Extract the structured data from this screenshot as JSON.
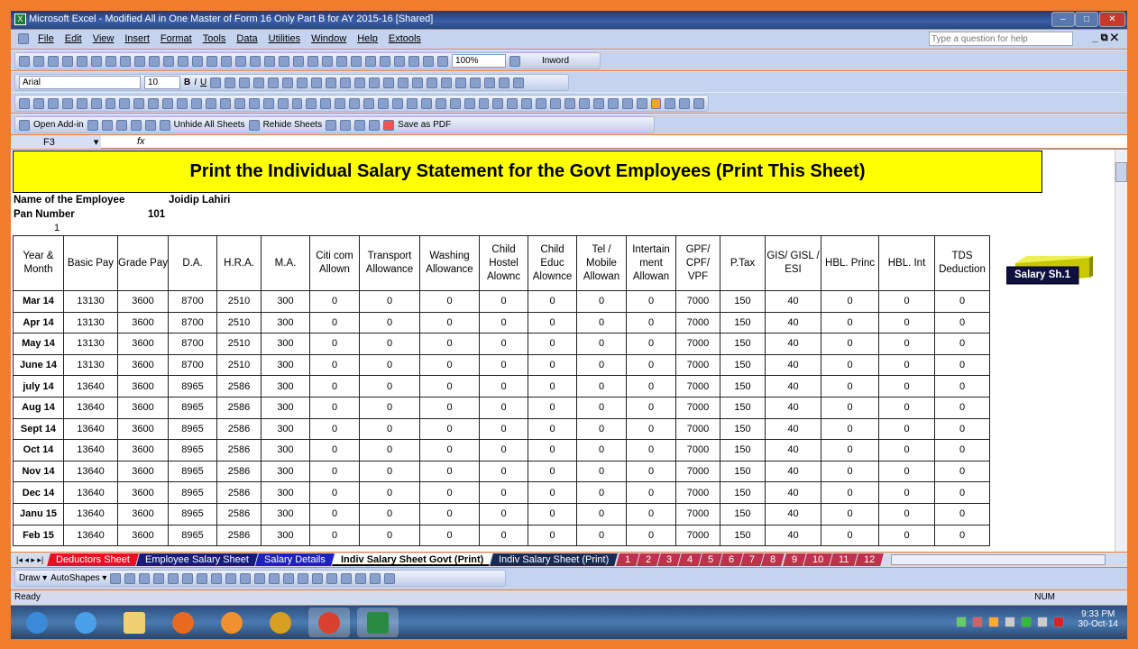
{
  "window": {
    "title": "Microsoft Excel - Modified All in One Master of Form 16 Only Part  B for AY 2015-16  [Shared]"
  },
  "menu": [
    "File",
    "Edit",
    "View",
    "Insert",
    "Format",
    "Tools",
    "Data",
    "Utilities",
    "Window",
    "Help",
    "Extools"
  ],
  "help_placeholder": "Type a question for help",
  "toolbar": {
    "zoom": "100%",
    "inword": "Inword",
    "font": "Arial",
    "size": "10",
    "open_addin": "Open Add-in",
    "unhide": "Unhide All Sheets",
    "rehide": "Rehide Sheets",
    "save_pdf": "Save as PDF"
  },
  "formula": {
    "cell": "F3",
    "fx": "fx"
  },
  "sheet": {
    "title": "Print the Individual Salary Statement for the Govt Employees (Print This Sheet)",
    "name_label": "Name of the Employee",
    "name_value": "Joidip Lahiri",
    "pan_label": "Pan Number",
    "pan_value": "101",
    "index": "1",
    "button": "Salary Sh.1",
    "headers": [
      "Year & Month",
      "Basic Pay",
      "Grade Pay",
      "D.A.",
      "H.R.A.",
      "M.A.",
      "Citi com Allown",
      "Transport Allowance",
      "Washing Allowance",
      "Child Hostel Alownc",
      "Child Educ Alownce",
      "Tel / Mobile Allowan",
      "Intertain ment Allowan",
      "GPF/ CPF/ VPF",
      "P.Tax",
      "GIS/ GISL / ESI",
      "HBL. Princ",
      "HBL. Int",
      "TDS Deduction"
    ],
    "rows": [
      [
        "Mar 14",
        "13130",
        "3600",
        "8700",
        "2510",
        "300",
        "0",
        "0",
        "0",
        "0",
        "0",
        "0",
        "0",
        "7000",
        "150",
        "40",
        "0",
        "0",
        "0"
      ],
      [
        "Apr 14",
        "13130",
        "3600",
        "8700",
        "2510",
        "300",
        "0",
        "0",
        "0",
        "0",
        "0",
        "0",
        "0",
        "7000",
        "150",
        "40",
        "0",
        "0",
        "0"
      ],
      [
        "May 14",
        "13130",
        "3600",
        "8700",
        "2510",
        "300",
        "0",
        "0",
        "0",
        "0",
        "0",
        "0",
        "0",
        "7000",
        "150",
        "40",
        "0",
        "0",
        "0"
      ],
      [
        "June 14",
        "13130",
        "3600",
        "8700",
        "2510",
        "300",
        "0",
        "0",
        "0",
        "0",
        "0",
        "0",
        "0",
        "7000",
        "150",
        "40",
        "0",
        "0",
        "0"
      ],
      [
        "july 14",
        "13640",
        "3600",
        "8965",
        "2586",
        "300",
        "0",
        "0",
        "0",
        "0",
        "0",
        "0",
        "0",
        "7000",
        "150",
        "40",
        "0",
        "0",
        "0"
      ],
      [
        "Aug 14",
        "13640",
        "3600",
        "8965",
        "2586",
        "300",
        "0",
        "0",
        "0",
        "0",
        "0",
        "0",
        "0",
        "7000",
        "150",
        "40",
        "0",
        "0",
        "0"
      ],
      [
        "Sept 14",
        "13640",
        "3600",
        "8965",
        "2586",
        "300",
        "0",
        "0",
        "0",
        "0",
        "0",
        "0",
        "0",
        "7000",
        "150",
        "40",
        "0",
        "0",
        "0"
      ],
      [
        "Oct 14",
        "13640",
        "3600",
        "8965",
        "2586",
        "300",
        "0",
        "0",
        "0",
        "0",
        "0",
        "0",
        "0",
        "7000",
        "150",
        "40",
        "0",
        "0",
        "0"
      ],
      [
        "Nov 14",
        "13640",
        "3600",
        "8965",
        "2586",
        "300",
        "0",
        "0",
        "0",
        "0",
        "0",
        "0",
        "0",
        "7000",
        "150",
        "40",
        "0",
        "0",
        "0"
      ],
      [
        "Dec 14",
        "13640",
        "3600",
        "8965",
        "2586",
        "300",
        "0",
        "0",
        "0",
        "0",
        "0",
        "0",
        "0",
        "7000",
        "150",
        "40",
        "0",
        "0",
        "0"
      ],
      [
        "Janu 15",
        "13640",
        "3600",
        "8965",
        "2586",
        "300",
        "0",
        "0",
        "0",
        "0",
        "0",
        "0",
        "0",
        "7000",
        "150",
        "40",
        "0",
        "0",
        "0"
      ],
      [
        "Feb 15",
        "13640",
        "3600",
        "8965",
        "2586",
        "300",
        "0",
        "0",
        "0",
        "0",
        "0",
        "0",
        "0",
        "7000",
        "150",
        "40",
        "0",
        "0",
        "0"
      ]
    ]
  },
  "tabs": [
    {
      "label": "Deductors Sheet",
      "bg": "#e8121e",
      "fg": "#ffffff"
    },
    {
      "label": "Employee Salary Sheet",
      "bg": "#1a1a7a",
      "fg": "#ffffff"
    },
    {
      "label": "Salary Details",
      "bg": "#2020c0",
      "fg": "#ffffff"
    },
    {
      "label": "Indiv Salary Sheet Govt (Print)",
      "bg": "#ffffff",
      "fg": "#000000",
      "active": true
    },
    {
      "label": "Indiv Salary Sheet (Print)",
      "bg": "#1a2a50",
      "fg": "#ffffff"
    },
    {
      "label": "1",
      "bg": "#c03050",
      "fg": "#fff"
    },
    {
      "label": "2",
      "bg": "#c03050",
      "fg": "#fff"
    },
    {
      "label": "3",
      "bg": "#c03050",
      "fg": "#fff"
    },
    {
      "label": "4",
      "bg": "#c03050",
      "fg": "#fff"
    },
    {
      "label": "5",
      "bg": "#c03050",
      "fg": "#fff"
    },
    {
      "label": "6",
      "bg": "#c03050",
      "fg": "#fff"
    },
    {
      "label": "7",
      "bg": "#c03050",
      "fg": "#fff"
    },
    {
      "label": "8",
      "bg": "#c03050",
      "fg": "#fff"
    },
    {
      "label": "9",
      "bg": "#c03050",
      "fg": "#fff"
    },
    {
      "label": "10",
      "bg": "#c03050",
      "fg": "#fff"
    },
    {
      "label": "11",
      "bg": "#c03050",
      "fg": "#fff"
    },
    {
      "label": "12",
      "bg": "#c03050",
      "fg": "#fff"
    }
  ],
  "drawbar": {
    "draw": "Draw ▾",
    "autoshapes": "AutoShapes ▾"
  },
  "status": {
    "ready": "Ready",
    "num": "NUM"
  },
  "taskbar": {
    "time": "9:33 PM",
    "date": "30-Oct-14",
    "apps": [
      "start",
      "internet-explorer",
      "file-explorer",
      "firefox",
      "media-player",
      "winamp",
      "chrome",
      "excel"
    ]
  }
}
